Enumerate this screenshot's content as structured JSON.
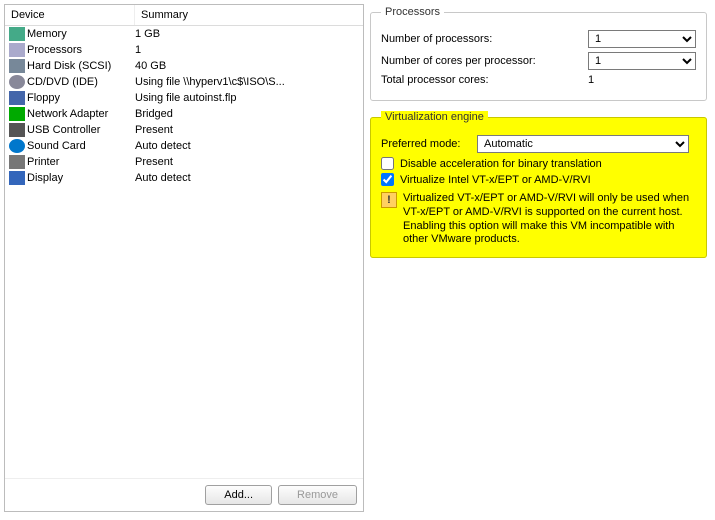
{
  "left": {
    "header_device": "Device",
    "header_summary": "Summary",
    "devices": [
      {
        "icon": "memory-icon",
        "cls": "ic-mem",
        "name": "Memory",
        "summary": "1 GB"
      },
      {
        "icon": "cpu-icon",
        "cls": "ic-cpu",
        "name": "Processors",
        "summary": "1"
      },
      {
        "icon": "hdd-icon",
        "cls": "ic-hdd",
        "name": "Hard Disk (SCSI)",
        "summary": "40 GB"
      },
      {
        "icon": "cd-icon",
        "cls": "ic-cd",
        "name": "CD/DVD (IDE)",
        "summary": "Using file \\\\hyperv1\\c$\\ISO\\S..."
      },
      {
        "icon": "floppy-icon",
        "cls": "ic-flp",
        "name": "Floppy",
        "summary": "Using file autoinst.flp"
      },
      {
        "icon": "nic-icon",
        "cls": "ic-net",
        "name": "Network Adapter",
        "summary": "Bridged"
      },
      {
        "icon": "usb-icon",
        "cls": "ic-usb",
        "name": "USB Controller",
        "summary": "Present"
      },
      {
        "icon": "sound-icon",
        "cls": "ic-snd",
        "name": "Sound Card",
        "summary": "Auto detect"
      },
      {
        "icon": "printer-icon",
        "cls": "ic-prn",
        "name": "Printer",
        "summary": "Present"
      },
      {
        "icon": "display-icon",
        "cls": "ic-dsp",
        "name": "Display",
        "summary": "Auto detect"
      }
    ],
    "add_label": "Add...",
    "remove_label": "Remove"
  },
  "processors": {
    "legend": "Processors",
    "num_label": "Number of processors:",
    "num_value": "1",
    "cores_label": "Number of cores per processor:",
    "cores_value": "1",
    "total_label": "Total processor cores:",
    "total_value": "1"
  },
  "virt": {
    "legend": "Virtualization engine",
    "mode_label": "Preferred mode:",
    "mode_value": "Automatic",
    "chk_disable_label": "Disable acceleration for binary translation",
    "chk_disable_checked": false,
    "chk_vtx_label": "Virtualize Intel VT-x/EPT or AMD-V/RVI",
    "chk_vtx_checked": true,
    "warn_text": "Virtualized VT-x/EPT or AMD-V/RVI will only be used when VT-x/EPT or AMD-V/RVI is supported on the current host. Enabling this option will make this VM incompatible with other VMware products."
  }
}
